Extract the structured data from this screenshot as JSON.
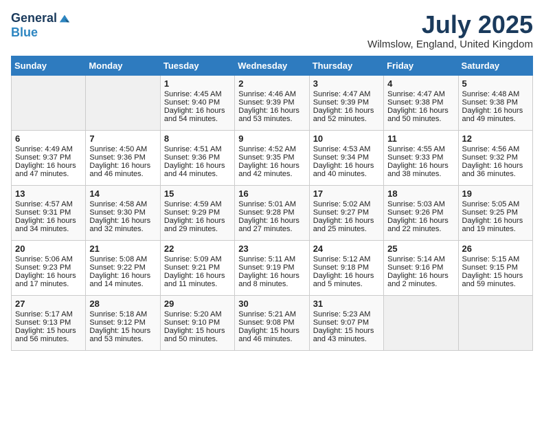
{
  "header": {
    "logo_general": "General",
    "logo_blue": "Blue",
    "title": "July 2025",
    "location": "Wilmslow, England, United Kingdom"
  },
  "days_of_week": [
    "Sunday",
    "Monday",
    "Tuesday",
    "Wednesday",
    "Thursday",
    "Friday",
    "Saturday"
  ],
  "weeks": [
    [
      {
        "day": "",
        "empty": true
      },
      {
        "day": "",
        "empty": true
      },
      {
        "day": "1",
        "sunrise": "Sunrise: 4:45 AM",
        "sunset": "Sunset: 9:40 PM",
        "daylight": "Daylight: 16 hours and 54 minutes."
      },
      {
        "day": "2",
        "sunrise": "Sunrise: 4:46 AM",
        "sunset": "Sunset: 9:39 PM",
        "daylight": "Daylight: 16 hours and 53 minutes."
      },
      {
        "day": "3",
        "sunrise": "Sunrise: 4:47 AM",
        "sunset": "Sunset: 9:39 PM",
        "daylight": "Daylight: 16 hours and 52 minutes."
      },
      {
        "day": "4",
        "sunrise": "Sunrise: 4:47 AM",
        "sunset": "Sunset: 9:38 PM",
        "daylight": "Daylight: 16 hours and 50 minutes."
      },
      {
        "day": "5",
        "sunrise": "Sunrise: 4:48 AM",
        "sunset": "Sunset: 9:38 PM",
        "daylight": "Daylight: 16 hours and 49 minutes."
      }
    ],
    [
      {
        "day": "6",
        "sunrise": "Sunrise: 4:49 AM",
        "sunset": "Sunset: 9:37 PM",
        "daylight": "Daylight: 16 hours and 47 minutes."
      },
      {
        "day": "7",
        "sunrise": "Sunrise: 4:50 AM",
        "sunset": "Sunset: 9:36 PM",
        "daylight": "Daylight: 16 hours and 46 minutes."
      },
      {
        "day": "8",
        "sunrise": "Sunrise: 4:51 AM",
        "sunset": "Sunset: 9:36 PM",
        "daylight": "Daylight: 16 hours and 44 minutes."
      },
      {
        "day": "9",
        "sunrise": "Sunrise: 4:52 AM",
        "sunset": "Sunset: 9:35 PM",
        "daylight": "Daylight: 16 hours and 42 minutes."
      },
      {
        "day": "10",
        "sunrise": "Sunrise: 4:53 AM",
        "sunset": "Sunset: 9:34 PM",
        "daylight": "Daylight: 16 hours and 40 minutes."
      },
      {
        "day": "11",
        "sunrise": "Sunrise: 4:55 AM",
        "sunset": "Sunset: 9:33 PM",
        "daylight": "Daylight: 16 hours and 38 minutes."
      },
      {
        "day": "12",
        "sunrise": "Sunrise: 4:56 AM",
        "sunset": "Sunset: 9:32 PM",
        "daylight": "Daylight: 16 hours and 36 minutes."
      }
    ],
    [
      {
        "day": "13",
        "sunrise": "Sunrise: 4:57 AM",
        "sunset": "Sunset: 9:31 PM",
        "daylight": "Daylight: 16 hours and 34 minutes."
      },
      {
        "day": "14",
        "sunrise": "Sunrise: 4:58 AM",
        "sunset": "Sunset: 9:30 PM",
        "daylight": "Daylight: 16 hours and 32 minutes."
      },
      {
        "day": "15",
        "sunrise": "Sunrise: 4:59 AM",
        "sunset": "Sunset: 9:29 PM",
        "daylight": "Daylight: 16 hours and 29 minutes."
      },
      {
        "day": "16",
        "sunrise": "Sunrise: 5:01 AM",
        "sunset": "Sunset: 9:28 PM",
        "daylight": "Daylight: 16 hours and 27 minutes."
      },
      {
        "day": "17",
        "sunrise": "Sunrise: 5:02 AM",
        "sunset": "Sunset: 9:27 PM",
        "daylight": "Daylight: 16 hours and 25 minutes."
      },
      {
        "day": "18",
        "sunrise": "Sunrise: 5:03 AM",
        "sunset": "Sunset: 9:26 PM",
        "daylight": "Daylight: 16 hours and 22 minutes."
      },
      {
        "day": "19",
        "sunrise": "Sunrise: 5:05 AM",
        "sunset": "Sunset: 9:25 PM",
        "daylight": "Daylight: 16 hours and 19 minutes."
      }
    ],
    [
      {
        "day": "20",
        "sunrise": "Sunrise: 5:06 AM",
        "sunset": "Sunset: 9:23 PM",
        "daylight": "Daylight: 16 hours and 17 minutes."
      },
      {
        "day": "21",
        "sunrise": "Sunrise: 5:08 AM",
        "sunset": "Sunset: 9:22 PM",
        "daylight": "Daylight: 16 hours and 14 minutes."
      },
      {
        "day": "22",
        "sunrise": "Sunrise: 5:09 AM",
        "sunset": "Sunset: 9:21 PM",
        "daylight": "Daylight: 16 hours and 11 minutes."
      },
      {
        "day": "23",
        "sunrise": "Sunrise: 5:11 AM",
        "sunset": "Sunset: 9:19 PM",
        "daylight": "Daylight: 16 hours and 8 minutes."
      },
      {
        "day": "24",
        "sunrise": "Sunrise: 5:12 AM",
        "sunset": "Sunset: 9:18 PM",
        "daylight": "Daylight: 16 hours and 5 minutes."
      },
      {
        "day": "25",
        "sunrise": "Sunrise: 5:14 AM",
        "sunset": "Sunset: 9:16 PM",
        "daylight": "Daylight: 16 hours and 2 minutes."
      },
      {
        "day": "26",
        "sunrise": "Sunrise: 5:15 AM",
        "sunset": "Sunset: 9:15 PM",
        "daylight": "Daylight: 15 hours and 59 minutes."
      }
    ],
    [
      {
        "day": "27",
        "sunrise": "Sunrise: 5:17 AM",
        "sunset": "Sunset: 9:13 PM",
        "daylight": "Daylight: 15 hours and 56 minutes."
      },
      {
        "day": "28",
        "sunrise": "Sunrise: 5:18 AM",
        "sunset": "Sunset: 9:12 PM",
        "daylight": "Daylight: 15 hours and 53 minutes."
      },
      {
        "day": "29",
        "sunrise": "Sunrise: 5:20 AM",
        "sunset": "Sunset: 9:10 PM",
        "daylight": "Daylight: 15 hours and 50 minutes."
      },
      {
        "day": "30",
        "sunrise": "Sunrise: 5:21 AM",
        "sunset": "Sunset: 9:08 PM",
        "daylight": "Daylight: 15 hours and 46 minutes."
      },
      {
        "day": "31",
        "sunrise": "Sunrise: 5:23 AM",
        "sunset": "Sunset: 9:07 PM",
        "daylight": "Daylight: 15 hours and 43 minutes."
      },
      {
        "day": "",
        "empty": true
      },
      {
        "day": "",
        "empty": true
      }
    ]
  ]
}
